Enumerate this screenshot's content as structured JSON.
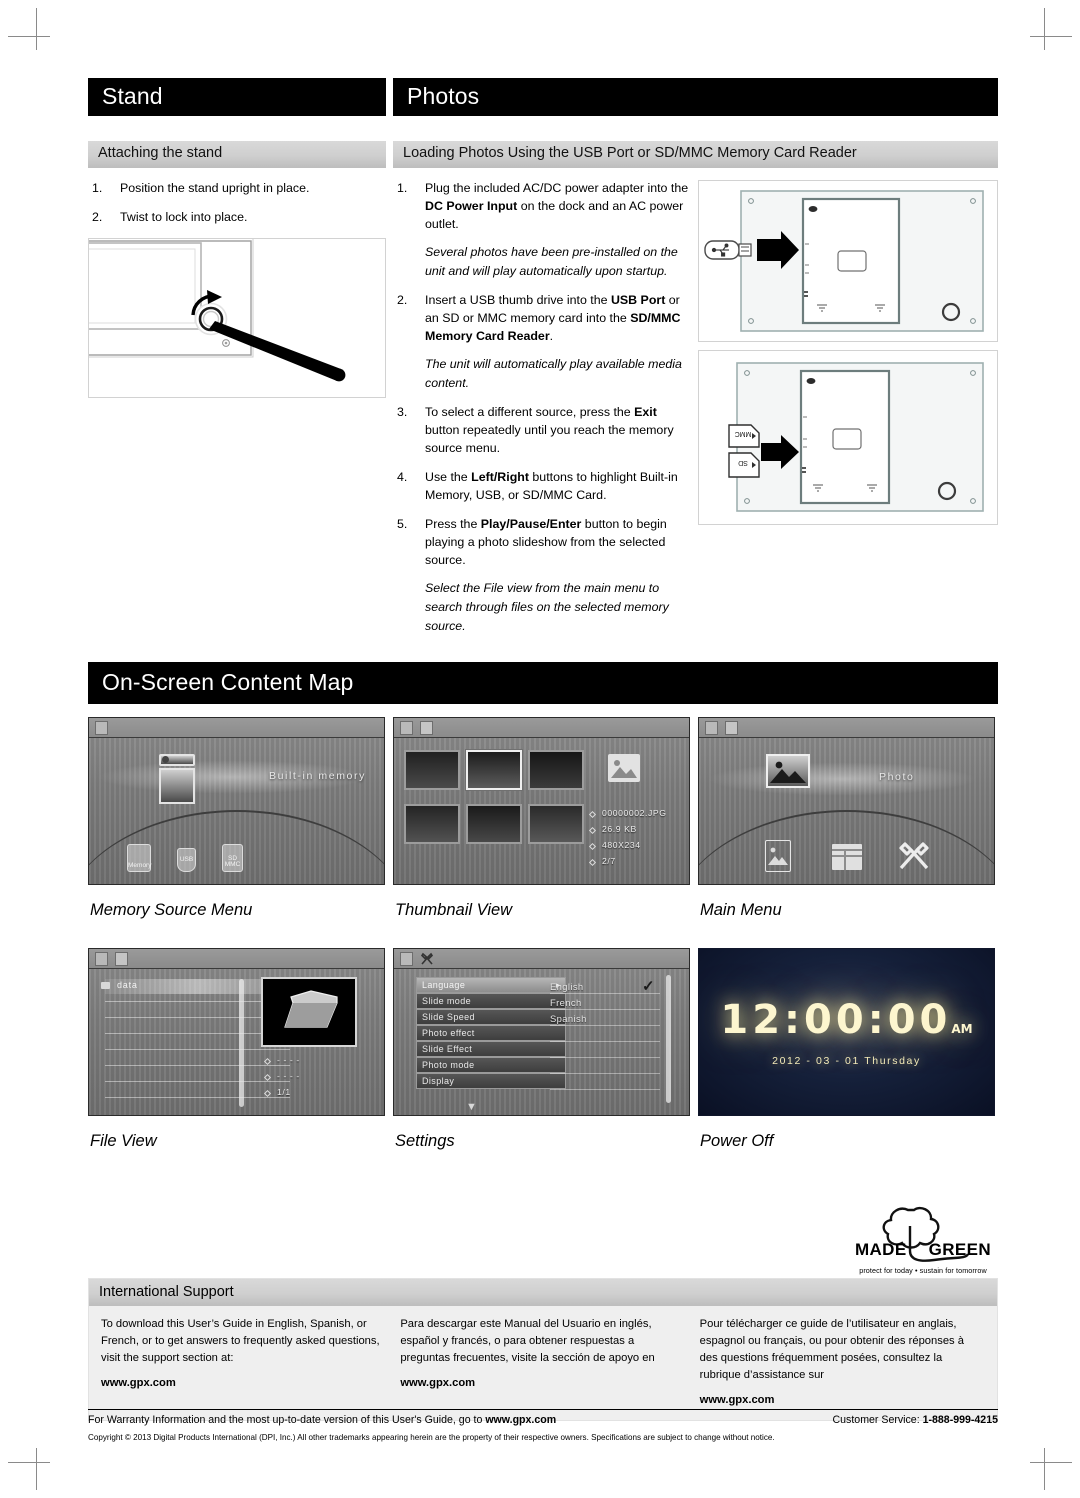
{
  "sections": {
    "stand": {
      "title": "Stand",
      "subhead": "Attaching the stand",
      "steps": [
        {
          "num": "1.",
          "text": "Position the stand upright in place."
        },
        {
          "num": "2.",
          "text": "Twist to lock into place."
        }
      ]
    },
    "photos": {
      "title": "Photos",
      "subhead": "Loading Photos Using the USB Port or SD/MMC Memory Card Reader",
      "steps": [
        {
          "num": "1.",
          "pre": "Plug the included AC/DC power adapter into the ",
          "bold": "DC Power Input",
          "post": " on the dock and an AC power outlet."
        },
        {
          "num": "2.",
          "pre": "Insert a USB thumb drive into the ",
          "bold": "USB Port",
          "mid": " or an SD or MMC memory card into the ",
          "bold2": "SD/MMC Memory Card Reader",
          "post": "."
        },
        {
          "num": "3.",
          "pre": "To select a different source, press the ",
          "bold": "Exit",
          "post": " button repeatedly until you reach the memory source menu."
        },
        {
          "num": "4.",
          "pre": "Use the ",
          "bold": "Left/Right",
          "post": " buttons to highlight Built-in Memory, USB, or SD/MMC Card."
        },
        {
          "num": "5.",
          "pre": "Press the ",
          "bold": "Play/Pause/Enter",
          "post": " button to begin playing a photo slideshow from the selected source."
        }
      ],
      "notes": [
        "Several photos have been pre-installed on the unit and will play automatically upon startup.",
        "The unit will automatically play available media content.",
        "Select the File view from the main menu to search through files on the selected memory source."
      ],
      "figure_labels": {
        "usb": "USB",
        "mmc": "MMC",
        "sd": "SD"
      }
    },
    "content_map": {
      "title": "On-Screen Content Map",
      "screens": [
        {
          "caption": "Memory Source Menu",
          "label": "Built-in memory",
          "icons": [
            "Memory",
            "USB",
            "SD MMC"
          ]
        },
        {
          "caption": "Thumbnail View",
          "meta": [
            "00000002.JPG",
            "26.9 KB",
            "480X234",
            "2/7"
          ]
        },
        {
          "caption": "Main Menu",
          "label": "Photo"
        },
        {
          "caption": "File View",
          "folder": "data",
          "meta": [
            "- - - -",
            "- - - -",
            "1/1"
          ]
        },
        {
          "caption": "Settings",
          "menu": [
            "Language",
            "Slide mode",
            "Slide Speed",
            "Photo effect",
            "Slide Effect",
            "Photo mode",
            "Display"
          ],
          "options": [
            "English",
            "French",
            "Spanish"
          ],
          "selected_option": "English"
        },
        {
          "caption": "Power Off",
          "time": "12:00:00",
          "meridiem": "AM",
          "date": "2012 - 03 - 01  Thursday"
        }
      ]
    }
  },
  "logo": {
    "made": "MADE",
    "green": "GREEN",
    "tagline": "protect for today • sustain for tomorrow"
  },
  "international_support": {
    "title": "International Support",
    "columns": [
      {
        "body": "To download this User’s Guide in English, Spanish, or French, or to get answers to frequently asked questions, visit the support section  at:",
        "url": "www.gpx.com"
      },
      {
        "body": "Para descargar este Manual del Usuario en inglés, español y francés, o para obtener respuestas a preguntas frecuentes, visite la sección de apoyo en",
        "url": "www.gpx.com"
      },
      {
        "body": "Pour télécharger ce guide de l’utilisateur en anglais, espagnol ou français, ou pour obtenir des réponses à des questions fréquemment posées, consultez la rubrique d’assistance sur",
        "url": "www.gpx.com"
      }
    ]
  },
  "footer": {
    "warranty_pre": "For Warranty Information and the most up-to-date version of this User's Guide, go to ",
    "warranty_url": "www.gpx.com",
    "service_label": "Customer Service: ",
    "service_number": "1-888-999-4215",
    "copyright": "Copyright © 2013 Digital Products International (DPI, Inc.) All other trademarks appearing herein are the property of their respective owners. Specifications are subject to change without notice."
  }
}
